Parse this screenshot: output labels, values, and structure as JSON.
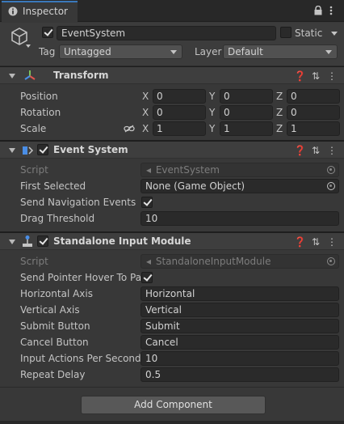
{
  "window": {
    "tab_label": "Inspector"
  },
  "object": {
    "name": "EventSystem",
    "active": true,
    "static_label": "Static",
    "static_checked": false,
    "tag_label": "Tag",
    "tag_value": "Untagged",
    "layer_label": "Layer",
    "layer_value": "Default"
  },
  "transform": {
    "title": "Transform",
    "rows": [
      {
        "label": "Position",
        "x": "0",
        "y": "0",
        "z": "0"
      },
      {
        "label": "Rotation",
        "x": "0",
        "y": "0",
        "z": "0"
      },
      {
        "label": "Scale",
        "x": "1",
        "y": "1",
        "z": "1"
      }
    ],
    "axes": [
      "X",
      "Y",
      "Z"
    ]
  },
  "event_system": {
    "title": "Event System",
    "enabled": true,
    "script_label": "Script",
    "script_value": "EventSystem",
    "first_selected_label": "First Selected",
    "first_selected_value": "None (Game Object)",
    "send_nav_label": "Send Navigation Events",
    "send_nav_checked": true,
    "drag_threshold_label": "Drag Threshold",
    "drag_threshold_value": "10"
  },
  "input_module": {
    "title": "Standalone Input Module",
    "enabled": true,
    "script_label": "Script",
    "script_value": "StandaloneInputModule",
    "send_pointer_label": "Send Pointer Hover To Par",
    "send_pointer_checked": true,
    "fields": [
      {
        "label": "Horizontal Axis",
        "value": "Horizontal"
      },
      {
        "label": "Vertical Axis",
        "value": "Vertical"
      },
      {
        "label": "Submit Button",
        "value": "Submit"
      },
      {
        "label": "Cancel Button",
        "value": "Cancel"
      },
      {
        "label": "Input Actions Per Second",
        "value": "10"
      },
      {
        "label": "Repeat Delay",
        "value": "0.5"
      }
    ]
  },
  "add_component_label": "Add Component",
  "icons": {
    "tab": "info-icon",
    "lock": "lock-icon",
    "menu": "kebab-menu-icon",
    "object": "cube-icon",
    "transform": "transform-axes-icon",
    "event_system": "event-system-icon",
    "input_module": "joystick-icon",
    "help": "help-icon",
    "preset": "preset-sliders-icon",
    "constrain": "link-icon"
  },
  "colors": {
    "accent": "#3a79bb",
    "background": "#383838",
    "field": "#2a2a2a"
  }
}
